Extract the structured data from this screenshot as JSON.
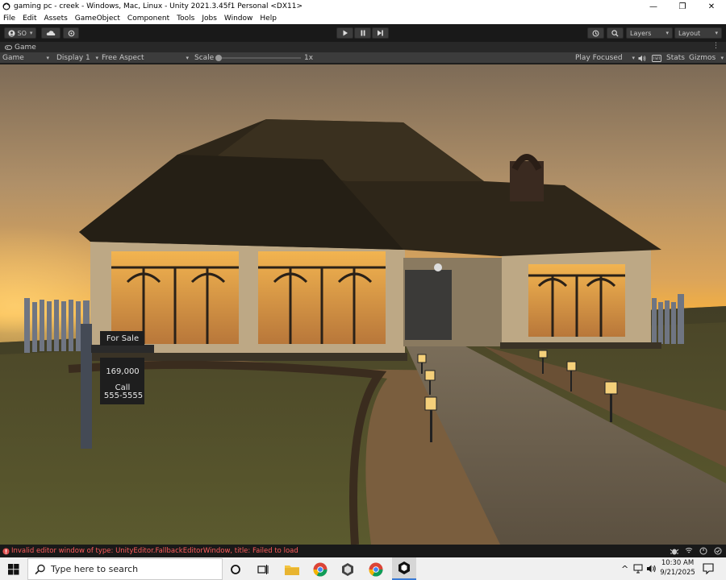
{
  "window": {
    "title": "gaming pc - creek - Windows, Mac, Linux - Unity 2021.3.45f1 Personal <DX11>",
    "controls": [
      "—",
      "❐",
      "✕"
    ]
  },
  "menu": [
    "File",
    "Edit",
    "Assets",
    "GameObject",
    "Component",
    "Tools",
    "Jobs",
    "Window",
    "Help"
  ],
  "toolbar": {
    "account": "SO",
    "layers": "Layers",
    "layout": "Layout"
  },
  "tab": {
    "label": "Game"
  },
  "game_toolbar": {
    "mode": "Game",
    "display": "Display 1",
    "aspect": "Free Aspect",
    "scale_label": "Scale",
    "scale_value": "1x",
    "play_focused": "Play Focused",
    "stats": "Stats",
    "gizmos": "Gizmos"
  },
  "scene": {
    "sign_title": "For Sale",
    "sign_price": "169,000",
    "sign_call": "Call",
    "sign_phone": "555-5555"
  },
  "status": {
    "error": "Invalid editor window of type: UnityEditor.FallbackEditorWindow, title: Failed to load"
  },
  "taskbar": {
    "search_placeholder": "Type here to search",
    "time": "10:30 AM",
    "date": "9/21/2025"
  },
  "colors": {
    "error_red": "#ff5c5c",
    "editor_dark": "#191919",
    "sky_glow": "#f5b040"
  }
}
